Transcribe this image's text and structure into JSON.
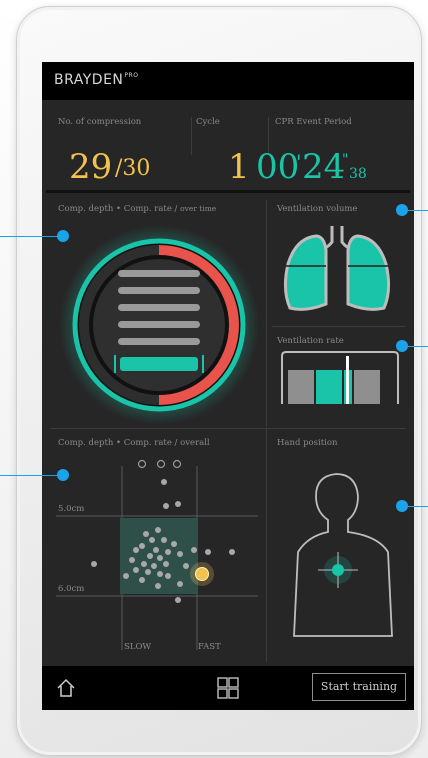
{
  "app": {
    "brand": "BRAYDEN",
    "brand_badge": "PRO"
  },
  "stats": {
    "compression_label": "No. of compression",
    "compression_count": "29",
    "compression_target": "/30",
    "cycle_label": "Cycle",
    "cycle_value": "1",
    "event_label": "CPR Event Period",
    "event_minutes": "00",
    "event_seconds": "24",
    "event_centis": "38"
  },
  "panels": {
    "depth_rate_overtime_a": "Comp. depth • Comp. rate / ",
    "depth_rate_overtime_b": "over time",
    "vent_volume": "Ventilation volume",
    "vent_rate": "Ventilation rate",
    "depth_rate_overall": "Comp. depth • Comp. rate / overall",
    "hand_position": "Hand position"
  },
  "scatter": {
    "depth_upper": "5.0cm",
    "depth_lower": "6.0cm",
    "slow": "SLOW",
    "fast": "FAST"
  },
  "toolbar": {
    "start_training": "Start training"
  },
  "colors": {
    "accent_teal": "#19c4a8",
    "accent_yellow": "#f2c14e",
    "alert_red": "#e8534b",
    "callout_blue": "#1aa3e8"
  },
  "icons": [
    "home-icon",
    "grid-icon"
  ]
}
